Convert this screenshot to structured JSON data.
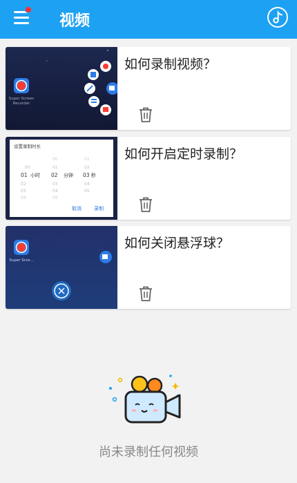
{
  "header": {
    "title": "视频",
    "menu_icon": "menu-icon",
    "music_icon": "music-icon",
    "notification_dot_color": "#ff2d2d",
    "accent": "#1da1f2"
  },
  "videos": [
    {
      "title": "如何录制视频？",
      "thumb": {
        "app_label_1": "Super Screen",
        "app_label_2": "Recorder"
      }
    },
    {
      "title": "如何开启定时录制？",
      "thumb": {
        "dialog_title": "设置录制时长",
        "hours": [
          "00",
          "01",
          "02",
          "03",
          "04"
        ],
        "hour_unit": "小时",
        "minutes": [
          "00",
          "01",
          "02",
          "03",
          "04",
          "05"
        ],
        "minute_unit": "分钟",
        "seconds": [
          "01",
          "02",
          "03",
          "04",
          "05"
        ],
        "second_unit": "秒",
        "cancel": "取消",
        "confirm": "录制"
      }
    },
    {
      "title": "如何关闭悬浮球？",
      "thumb": {
        "app_label": "Super Scre..."
      }
    }
  ],
  "empty_state": {
    "label": "尚未录制任何视频"
  }
}
